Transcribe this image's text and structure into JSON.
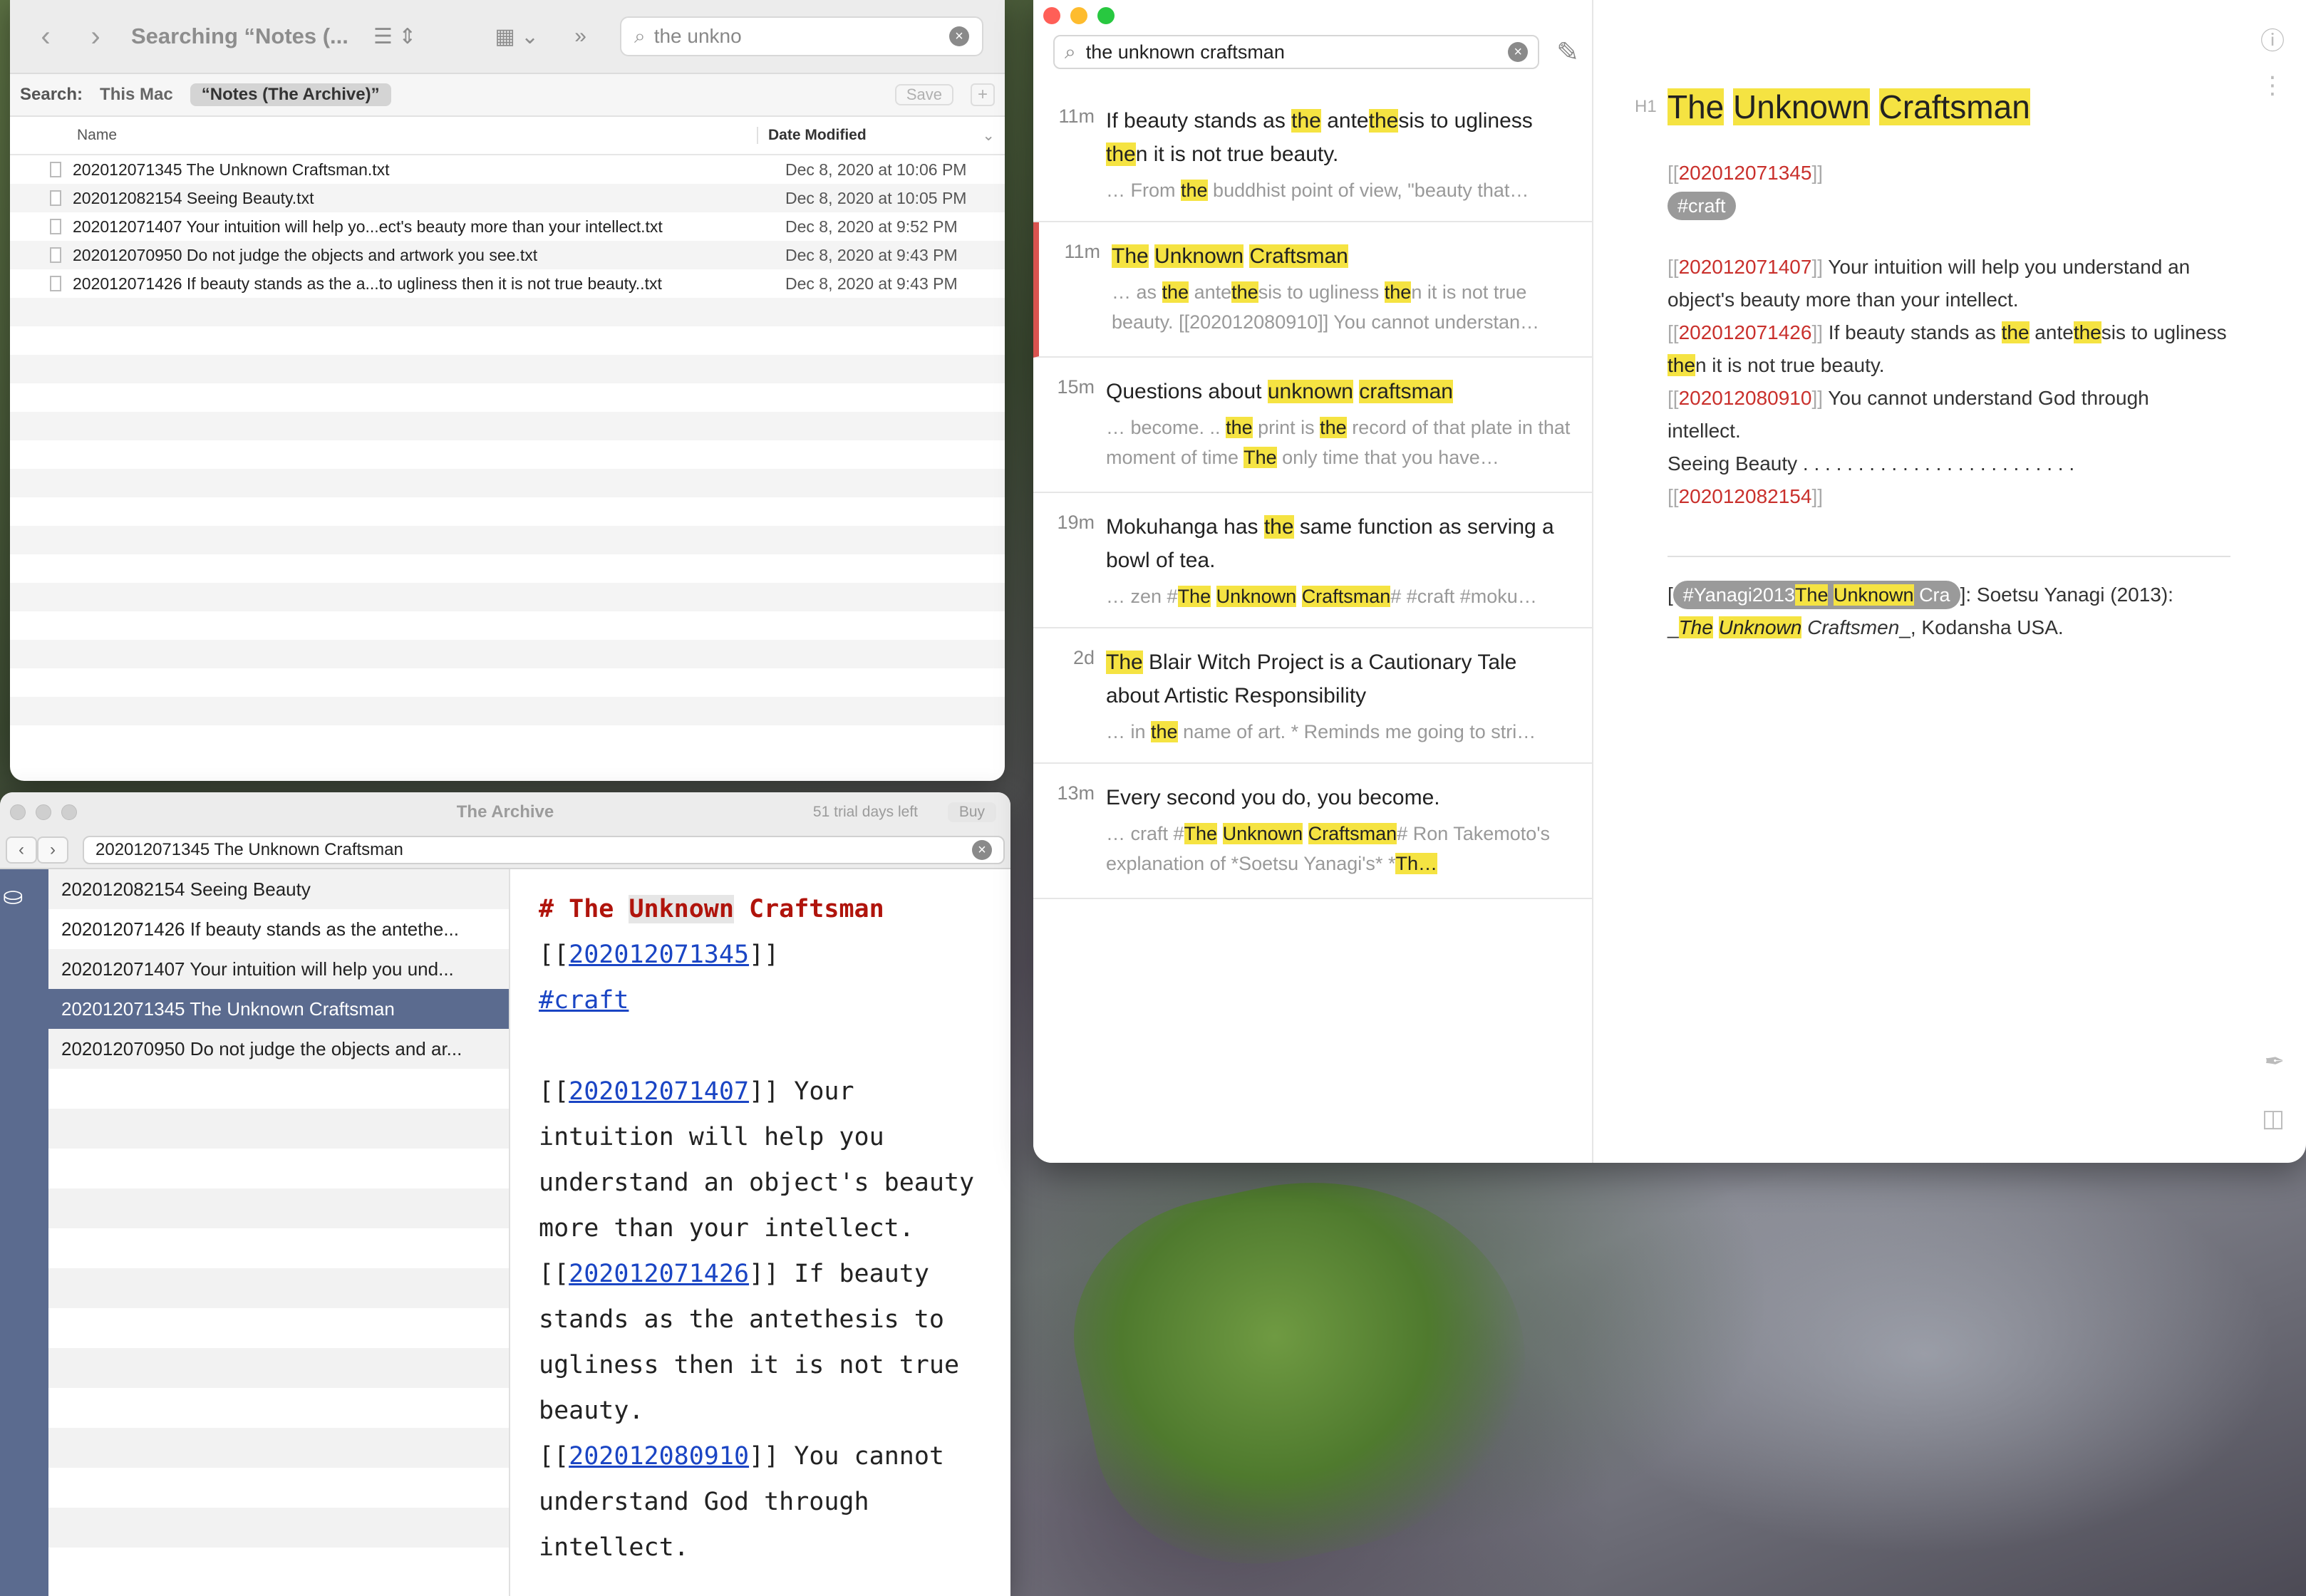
{
  "finder": {
    "title": "Searching “Notes (...",
    "search_value": "the unkno",
    "scope_label": "Search:",
    "scope_this_mac": "This Mac",
    "scope_selected": "“Notes (The Archive)”",
    "save_label": "Save",
    "col_name": "Name",
    "col_date": "Date Modified",
    "files": [
      {
        "name": "202012071345 The Unknown Craftsman.txt",
        "date": "Dec 8, 2020 at 10:06 PM"
      },
      {
        "name": "202012082154 Seeing Beauty.txt",
        "date": "Dec 8, 2020 at 10:05 PM"
      },
      {
        "name": "202012071407 Your intuition will help yo...ect's beauty more than your intellect.txt",
        "date": "Dec 8, 2020 at 9:52 PM"
      },
      {
        "name": "202012070950 Do not judge the objects and artwork you see.txt",
        "date": "Dec 8, 2020 at 9:43 PM"
      },
      {
        "name": "202012071426 If beauty stands as the a...to ugliness then it is not true beauty..txt",
        "date": "Dec 8, 2020 at 9:43 PM"
      }
    ]
  },
  "archive": {
    "title": "The Archive",
    "trial": "51 trial days left",
    "buy": "Buy",
    "search_value": "202012071345 The Unknown Craftsman",
    "notes": [
      "202012082154 Seeing Beauty",
      "202012071426 If beauty stands as the antethe...",
      "202012071407 Your intuition will help you und...",
      "202012071345 The Unknown Craftsman",
      "202012070950 Do not judge the objects and ar..."
    ],
    "editor": {
      "heading_hash": "# The ",
      "heading_word": "Unknown",
      "heading_rest": " Craftsman",
      "link1": "202012071345",
      "tag": "#craft",
      "link2": "202012071407",
      "text2": " Your intuition will help you understand an object's beauty more than your intellect.",
      "link3": "202012071426",
      "text3": " If beauty stands as the antethesis to ugliness then it is not true beauty.",
      "link4": "202012080910",
      "text4": " You cannot understand God through intellect."
    }
  },
  "notes_app": {
    "search_value": "the unknown craftsman",
    "results": [
      {
        "time": "11m",
        "title_html": "If beauty stands as <span class=\"y\">the</span> ante<span class=\"y\">the</span>sis to ugliness <span class=\"y\">the</span>n it is not true beauty.",
        "snip_html": "… From <span class=\"y\">the</span> buddhist point of view, \"beauty that…"
      },
      {
        "time": "11m",
        "title_html": "<span class=\"y\">The</span> <span class=\"y\">Unknown</span> <span class=\"y\">Craftsman</span>",
        "snip_html": "… as <span class=\"y\">the</span> ante<span class=\"y\">the</span>sis to ugliness <span class=\"y\">the</span>n it is not true beauty. [[202012080910]] You cannot understan…"
      },
      {
        "time": "15m",
        "title_html": "Questions about <span class=\"y\">unknown</span> <span class=\"y\">craftsman</span>",
        "snip_html": "… become.  .. <span class=\"y\">the</span> print is <span class=\"y\">the</span> record of that plate in that moment of time <span class=\"y\">The</span> only time that you have…"
      },
      {
        "time": "19m",
        "title_html": "Mokuhanga has <span class=\"y\">the</span> same function as serving a bowl of tea.",
        "snip_html": "… zen #<span class=\"y\">The</span> <span class=\"y\">Unknown</span> <span class=\"y\">Craftsman</span># #craft #moku…"
      },
      {
        "time": "2d",
        "title_html": "<span class=\"y\">The</span> Blair Witch Project is a Cautionary Tale about Artistic Responsibility",
        "snip_html": "… in <span class=\"y\">the</span> name of art.  * Reminds me going to stri…"
      },
      {
        "time": "13m",
        "title_html": "Every second you do, you become.",
        "snip_html": "… craft  #<span class=\"y\">The</span> <span class=\"y\">Unknown</span> <span class=\"y\">Craftsman</span># Ron Takemoto's explanation of *Soetsu Yanagi's* *<span class=\"y\">Th…</span>"
      }
    ],
    "preview": {
      "h1_tag": "H1",
      "w1": "The",
      "w2": "Unknown",
      "w3": "Craftsman",
      "id": "202012071345",
      "tag": "#craft",
      "l2": "202012071407",
      "t2": " Your intuition will help you understand an object's beauty more than your intellect.",
      "l3": "202012071426",
      "t3a": " If beauty stands as ",
      "t3b": "the",
      "t3c": " ante",
      "t3d": "the",
      "t3e": "sis to ugliness ",
      "t3f": "the",
      "t3g": "n it is not true beauty.",
      "l4": "202012080910",
      "t4": " You cannot understand God through intellect.",
      "seeing": "Seeing Beauty . . . . . . . . . . . . . . . . . . . . . . . . . ",
      "l5": "202012082154",
      "ref_tag": "#Yanagi2013",
      "ref_w1": "The",
      "ref_w2": "Unknown",
      "ref_tail": "Cra",
      "ref_text": "]: Soetsu Yanagi (2013):",
      "ref_under": "_",
      "ref_i1": "The",
      "ref_i2": "Unknown",
      "ref_i3": " Craftsmen",
      "ref_end": "_, Kodansha USA."
    },
    "colors": {
      "highlight": "#f5e342",
      "link": "#c9302c",
      "active_bar": "#d9534f"
    }
  }
}
